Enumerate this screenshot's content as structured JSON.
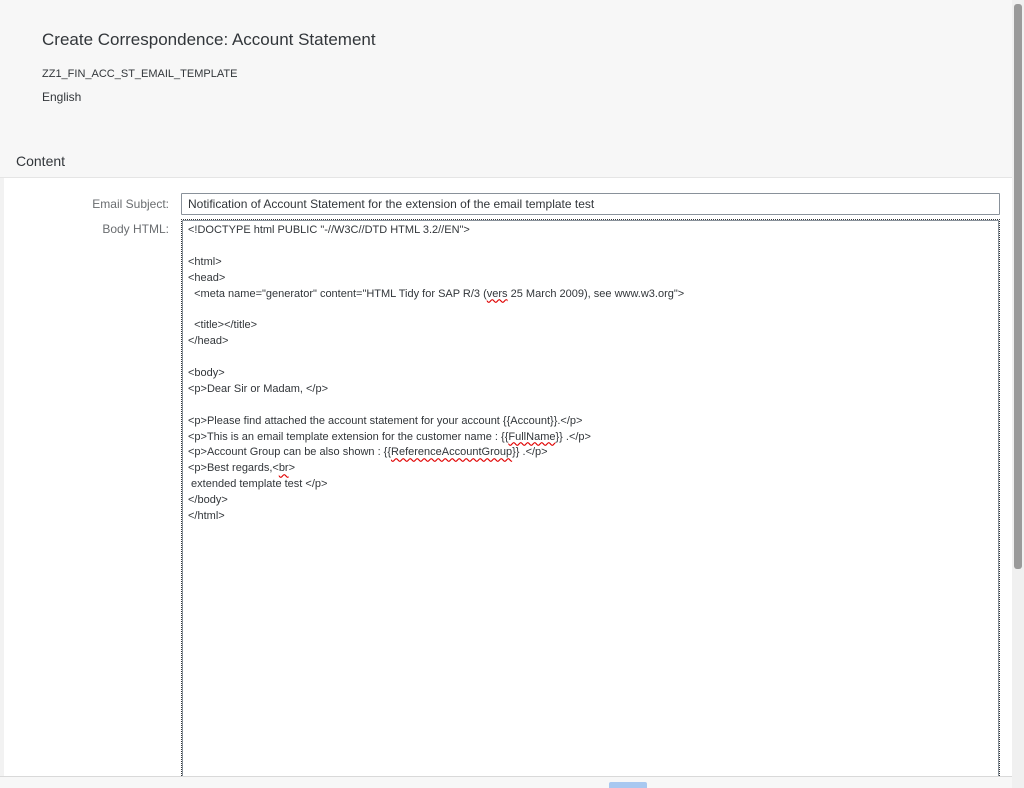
{
  "header": {
    "title": "Create Correspondence: Account Statement",
    "template_id": "ZZ1_FIN_ACC_ST_EMAIL_TEMPLATE",
    "language": "English"
  },
  "section": {
    "title": "Content"
  },
  "form": {
    "subject_label": "Email Subject:",
    "subject_value": "Notification of Account Statement for the extension of the email template test",
    "body_label": "Body HTML:"
  },
  "body_lines": [
    "<!DOCTYPE html PUBLIC \"-//W3C//DTD HTML 3.2//EN\">",
    "",
    "<html>",
    "<head>",
    "  <meta name=\"generator\" content=\"HTML Tidy for SAP R/3 (vers 25 March 2009), see www.w3.org\">",
    "",
    "  <title></title>",
    "</head>",
    "",
    "<body>",
    "<p>Dear Sir or Madam, </p>",
    "",
    "<p>Please find attached the account statement for your account {{Account}}.</p>",
    "<p>This is an email template extension for the customer name : {{FullName}} .</p>",
    "<p>Account Group can be also shown : {{ReferenceAccountGroup}} .</p>",
    "<p>Best regards,<br>",
    " extended template test </p>",
    "</body>",
    "</html>"
  ],
  "spellcheck_words": [
    "vers",
    "FullName",
    "ReferenceAccountGroup",
    "br"
  ],
  "colors": {
    "header_bg": "#f7f7f7",
    "text": "#32363a",
    "label": "#6a6d70",
    "input_border": "#89919a",
    "spell_error": "#e00000"
  }
}
